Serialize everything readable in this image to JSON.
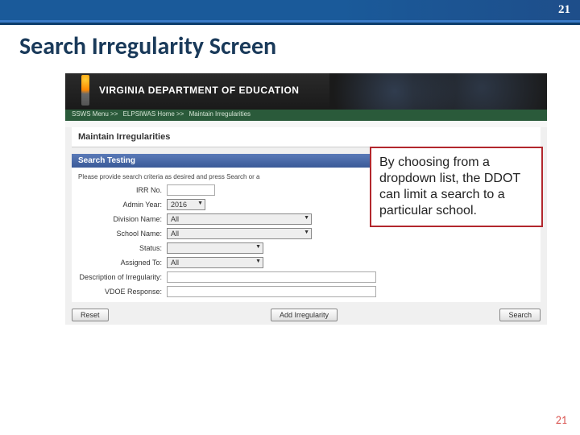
{
  "slide": {
    "number_top": "21",
    "number_bottom": "21",
    "title": "Search Irregularity Screen"
  },
  "callout": {
    "text": "By choosing from a dropdown list, the DDOT can limit a search to a particular school."
  },
  "ss": {
    "dept": "VIRGINIA DEPARTMENT OF EDUCATION",
    "breadcrumb": {
      "a": "SSWS Menu >>",
      "b": "ELPSIWAS Home >>",
      "c": "Maintain Irregularities"
    },
    "section_title": "Maintain Irregularities",
    "blue_bar": "Search Testing",
    "instructions": "Please provide search criteria as desired and press Search or a",
    "labels": {
      "irr": "IRR No.",
      "admin_year": "Admin Year:",
      "division": "Division Name:",
      "school": "School Name:",
      "status": "Status:",
      "assigned": "Assigned To:",
      "desc": "Description of Irregularity:",
      "vdoe": "VDOE Response:"
    },
    "values": {
      "admin_year": "2016",
      "division": "All",
      "school": "All",
      "status": "",
      "assigned": "All"
    },
    "buttons": {
      "reset": "Reset",
      "add": "Add Irregularity",
      "search": "Search"
    }
  }
}
